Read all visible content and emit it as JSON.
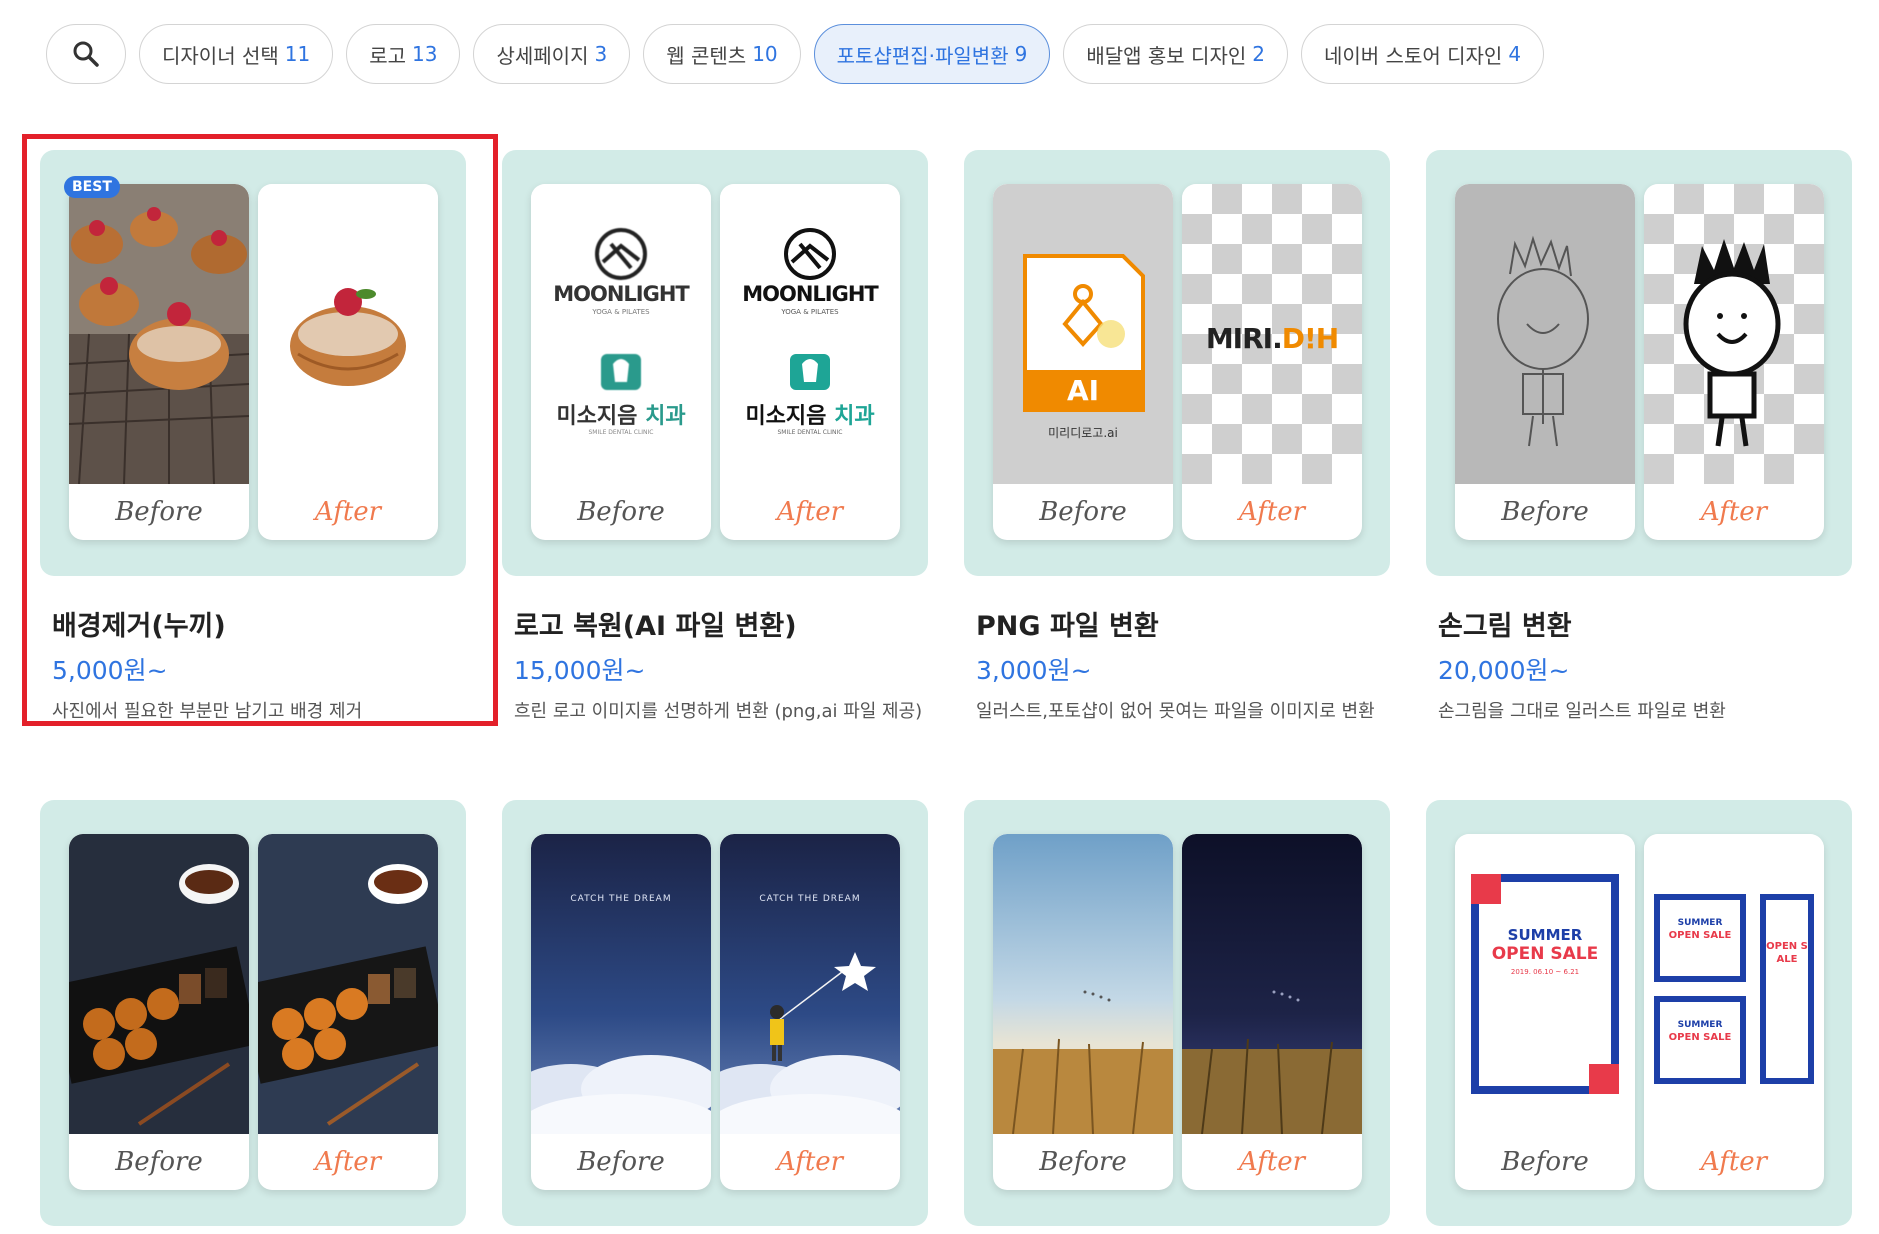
{
  "filters": {
    "search_icon": "search-icon",
    "items": [
      {
        "label": "디자이너 선택",
        "count": "11"
      },
      {
        "label": "로고",
        "count": "13"
      },
      {
        "label": "상세페이지",
        "count": "3"
      },
      {
        "label": "웹 콘텐츠",
        "count": "10"
      },
      {
        "label": "포토샵편집·파일변환",
        "count": "9"
      },
      {
        "label": "배달앱 홍보 디자인",
        "count": "2"
      },
      {
        "label": "네이버 스토어 디자인",
        "count": "4"
      }
    ],
    "active_index": 4
  },
  "common": {
    "before": "Before",
    "after": "After",
    "best": "BEST"
  },
  "products": [
    {
      "title": "배경제거(누끼)",
      "price": "5,000원~",
      "desc": "사진에서 필요한 부분만 남기고 배경 제거"
    },
    {
      "title": "로고 복원(AI 파일 변환)",
      "price": "15,000원~",
      "desc": "흐린 로고 이미지를 선명하게 변환 (png,ai 파일 제공)"
    },
    {
      "title": "PNG 파일 변환",
      "price": "3,000원~",
      "desc": "일러스트,포토샵이 없어 못여는 파일을 이미지로 변환"
    },
    {
      "title": "손그림 변환",
      "price": "20,000원~",
      "desc": "손그림을 그대로 일러스트 파일로 변환"
    }
  ],
  "artwork": {
    "moonlight": "MOONLIGHT",
    "moonlight_sub": "YOGA & PILATES",
    "dental": "미소지음",
    "dental_accent": "치과",
    "dental_sub": "SMILE DENTAL CLINIC",
    "ai_label": "AI",
    "ai_file": "미리디로고.ai",
    "miri": "MIRI.",
    "miri_accent": "D!H",
    "catch": "CATCH THE DREAM",
    "summer": "SUMMER",
    "open_sale": "OPEN SALE",
    "sale_date": "2019. 06.10 ~ 6.21"
  },
  "colors": {
    "accent": "#2f74e0",
    "after": "#f07a4e",
    "card_bg": "#d2ebe7",
    "highlight": "#e3202a"
  }
}
